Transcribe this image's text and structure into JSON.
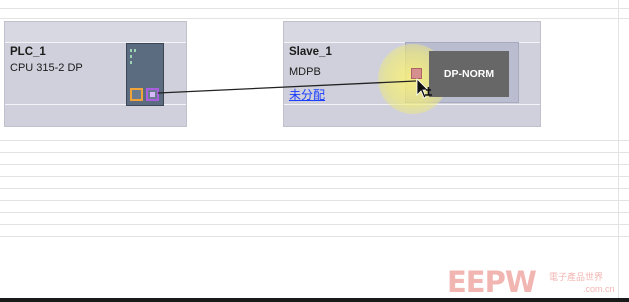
{
  "devices": {
    "plc": {
      "name": "PLC_1",
      "type": "CPU 315-2 DP"
    },
    "slave": {
      "name": "Slave_1",
      "type": "MDPB",
      "assign_link": "未分配"
    }
  },
  "network": {
    "label": "DP-NORM"
  },
  "watermark": {
    "logo": "EEPW",
    "chinese": "電子產品世界",
    "url": ".com.cn"
  },
  "colors": {
    "device_bg": "#cfd0db",
    "dp_norm_bg": "#676767",
    "link": "#1a3dff",
    "orange_port": "#f0a43a",
    "purple_port": "#a95fe0"
  },
  "icons": [
    "cpu-module-icon",
    "mouse-pointer-icon",
    "network-connect-cursor-icon"
  ]
}
